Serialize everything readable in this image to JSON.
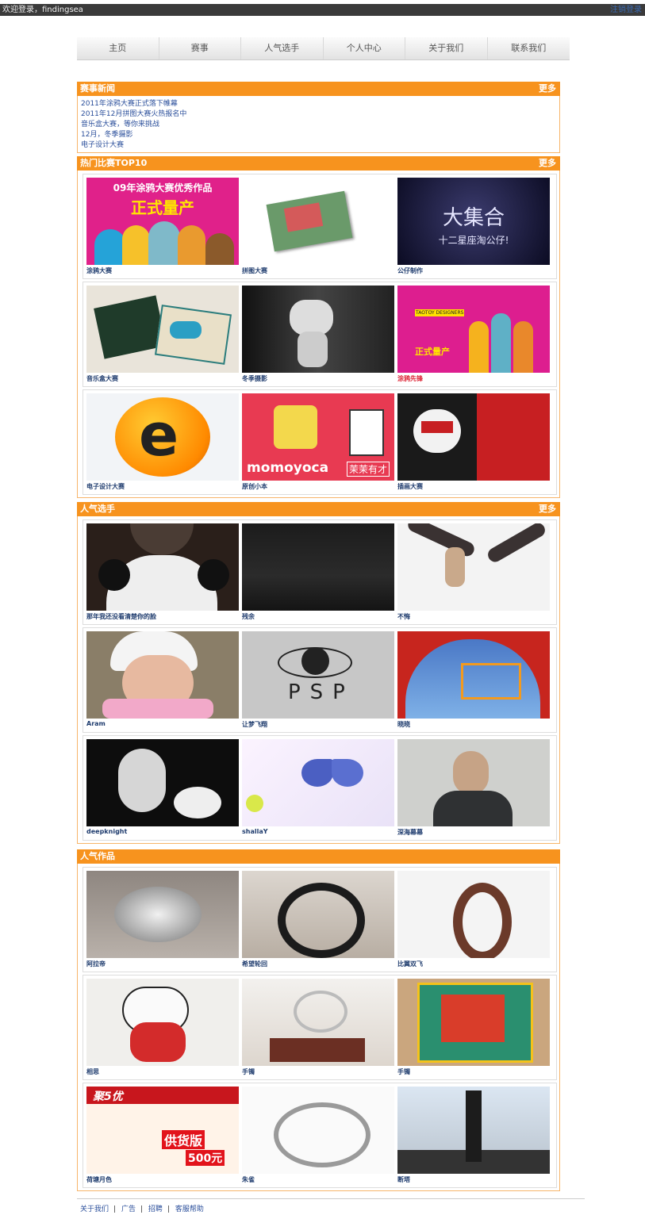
{
  "topbar": {
    "welcome": "欢迎登录，findingsea",
    "logout": "注销登录"
  },
  "nav": [
    "主页",
    "赛事",
    "人气选手",
    "个人中心",
    "关于我们",
    "联系我们"
  ],
  "news": {
    "title": "赛事新闻",
    "more": "更多",
    "items": [
      "2011年涂鸦大赛正式落下帷幕",
      "2011年12月拼图大赛火热报名中",
      "音乐盒大赛，等你来挑战",
      "12月，冬季摄影",
      "电子设计大赛"
    ]
  },
  "top10": {
    "title": "热门比赛TOP10",
    "more": "更多",
    "items": [
      {
        "caption": "涂鸦大赛",
        "art": "poster",
        "thumb_text": [
          "09年涂鸦大赛优秀作品",
          "正式量产"
        ]
      },
      {
        "caption": "拼图大赛",
        "art": "puzzle"
      },
      {
        "caption": "公仔制作",
        "art": "space",
        "thumb_text": [
          "大集合",
          "十二星座淘公仔!"
        ]
      },
      {
        "caption": "音乐盒大赛",
        "art": "cards"
      },
      {
        "caption": "冬季摄影",
        "art": "figure"
      },
      {
        "caption": "涂鸦先锋",
        "art": "toys",
        "red": true,
        "thumb_text": [
          "TAOTOY DESIGNERS",
          "正式量产"
        ]
      },
      {
        "caption": "电子设计大赛",
        "art": "elogo",
        "thumb_text": [
          "e"
        ]
      },
      {
        "caption": "原创小本",
        "art": "momoyoca",
        "thumb_text": [
          "momoyoca",
          "茉茉有才"
        ]
      },
      {
        "caption": "插画大赛",
        "art": "illus"
      }
    ]
  },
  "players": {
    "title": "人气选手",
    "more": "更多",
    "items": [
      {
        "caption": "那年我还没看清楚你的脸",
        "art": "panda"
      },
      {
        "caption": "残余",
        "art": "dark"
      },
      {
        "caption": "不悔",
        "art": "hands"
      },
      {
        "caption": "Aram",
        "art": "girl"
      },
      {
        "caption": "让梦飞翔",
        "art": "eye",
        "thumb_text": [
          "PSP"
        ]
      },
      {
        "caption": "晓晓",
        "art": "blue"
      },
      {
        "caption": "deepknight",
        "art": "bwface"
      },
      {
        "caption": "shallaY",
        "art": "butterfly"
      },
      {
        "caption": "深海幕幕",
        "art": "man"
      }
    ]
  },
  "works": {
    "title": "人气作品",
    "items": [
      {
        "caption": "阿拉帝",
        "art": "silver"
      },
      {
        "caption": "希望轮回",
        "art": "ring1"
      },
      {
        "caption": "比翼双飞",
        "art": "ring2"
      },
      {
        "caption": "相思",
        "art": "doll"
      },
      {
        "caption": "手镯",
        "art": "ring3"
      },
      {
        "caption": "手镯",
        "art": "totem"
      },
      {
        "caption": "荷塘月色",
        "art": "ad",
        "thumb_text": [
          "聚5优",
          "供货版",
          "500元"
        ]
      },
      {
        "caption": "朱雀",
        "art": "ring4"
      },
      {
        "caption": "断塔",
        "art": "tower"
      }
    ]
  },
  "footer": [
    "关于我们",
    "广告",
    "招聘",
    "客服帮助"
  ]
}
